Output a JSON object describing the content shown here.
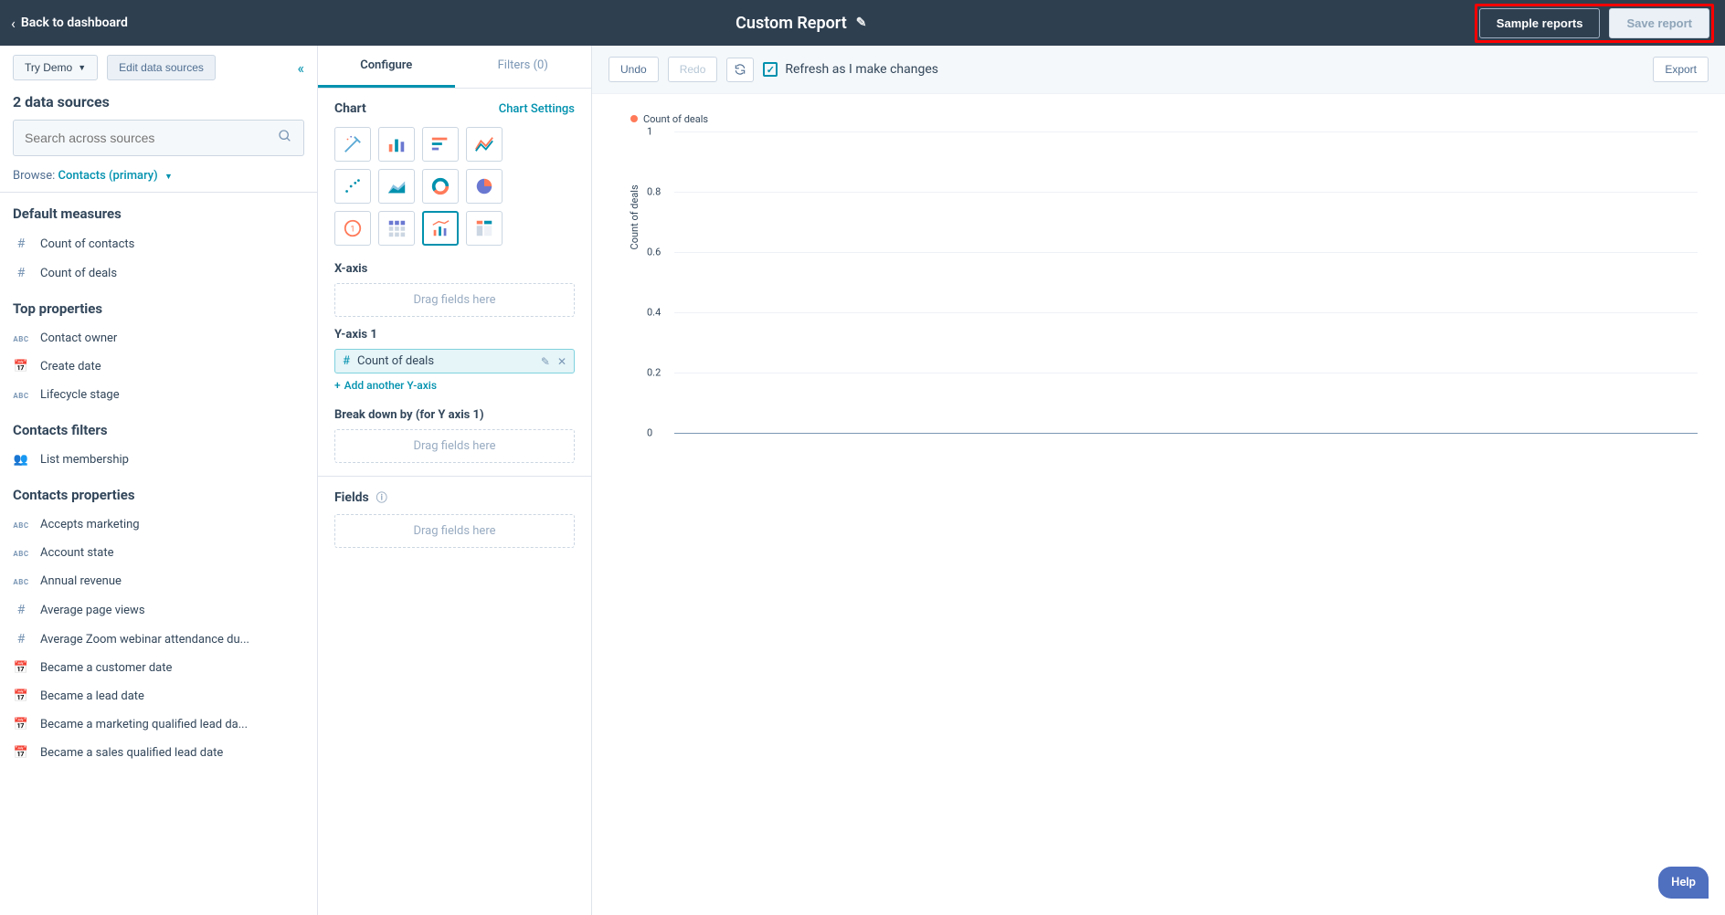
{
  "header": {
    "back_label": "Back to dashboard",
    "title": "Custom Report",
    "sample_reports": "Sample reports",
    "save_report": "Save report"
  },
  "left": {
    "try_demo": "Try Demo",
    "edit_sources": "Edit data sources",
    "ds_count_title": "2 data sources",
    "search_placeholder": "Search across sources",
    "browse_label": "Browse:",
    "browse_value": "Contacts (primary)",
    "sections": {
      "default_measures": "Default measures",
      "top_properties": "Top properties",
      "contacts_filters": "Contacts filters",
      "contacts_properties": "Contacts properties"
    },
    "items": {
      "count_contacts": "Count of contacts",
      "count_deals": "Count of deals",
      "contact_owner": "Contact owner",
      "create_date": "Create date",
      "lifecycle_stage": "Lifecycle stage",
      "list_membership": "List membership",
      "accepts_marketing": "Accepts marketing",
      "account_state": "Account state",
      "annual_revenue": "Annual revenue",
      "avg_page_views": "Average page views",
      "avg_zoom": "Average Zoom webinar attendance du...",
      "became_customer": "Became a customer date",
      "became_lead": "Became a lead date",
      "became_mql": "Became a marketing qualified lead da...",
      "became_sql": "Became a sales qualified lead date"
    }
  },
  "config": {
    "tab_configure": "Configure",
    "tab_filters": "Filters (0)",
    "chart_heading": "Chart",
    "chart_settings": "Chart Settings",
    "xaxis_label": "X-axis",
    "yaxis_label": "Y-axis 1",
    "yaxis_chip": "Count of deals",
    "add_yaxis": "Add another Y-axis",
    "breakdown_label": "Break down by (for Y axis 1)",
    "fields_label": "Fields",
    "drag_here": "Drag fields here"
  },
  "toolbar": {
    "undo": "Undo",
    "redo": "Redo",
    "refresh_label": "Refresh as I make changes",
    "export": "Export"
  },
  "chart_data": {
    "type": "bar",
    "title": "",
    "legend": [
      "Count of deals"
    ],
    "ylabel": "Count of deals",
    "yticks": [
      0,
      0.2,
      0.4,
      0.6,
      0.8,
      1
    ],
    "ylim": [
      0,
      1
    ],
    "categories": [],
    "series": [
      {
        "name": "Count of deals",
        "values": [],
        "color": "#ff7a59"
      }
    ]
  },
  "help": "Help"
}
